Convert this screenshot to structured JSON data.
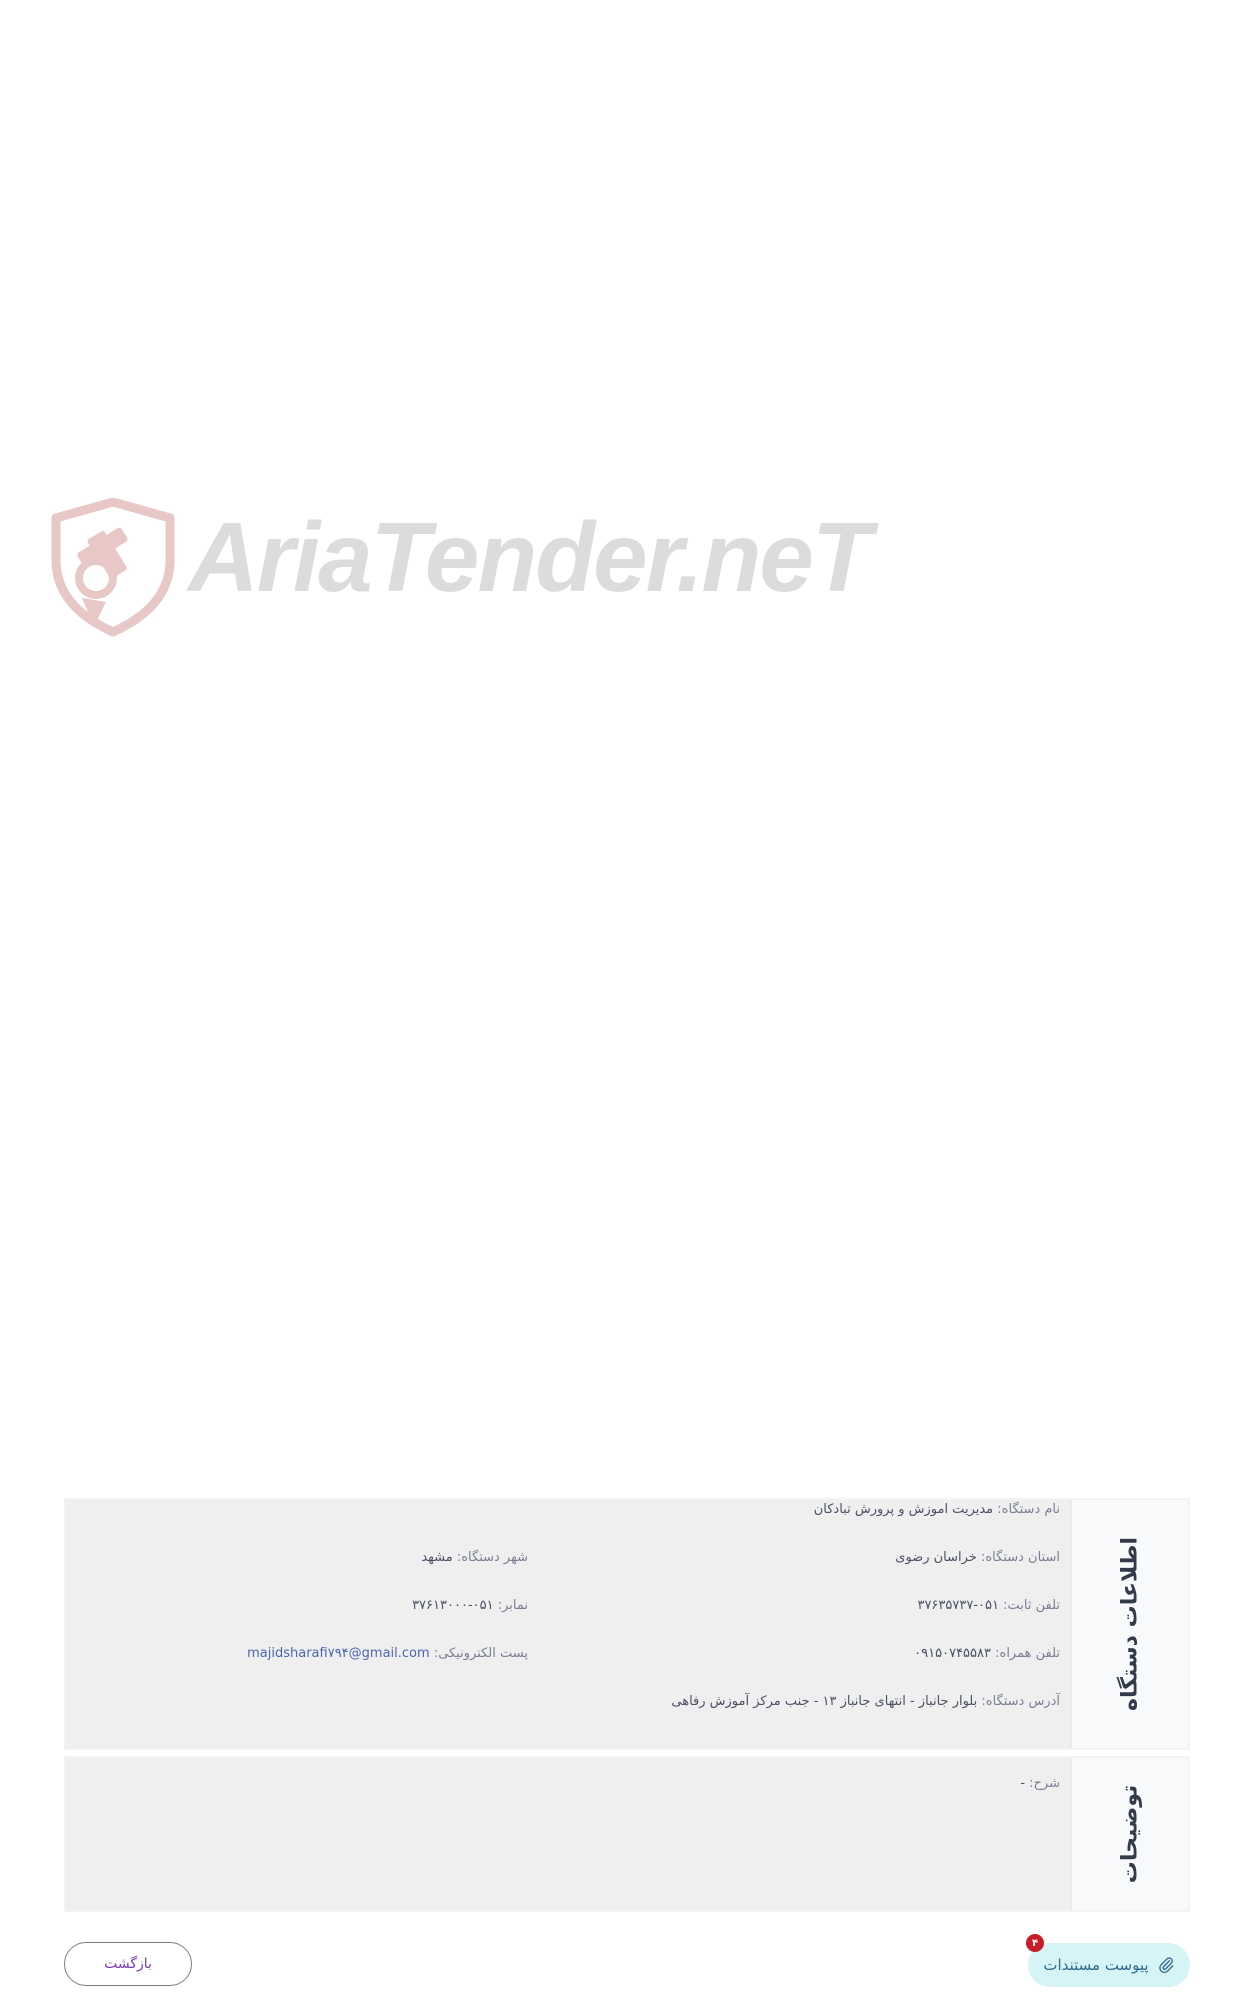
{
  "watermark": {
    "brand_text": "AriaTender.neT",
    "logo_color": "#e8c7c7",
    "text_color": "#dcdcdc"
  },
  "device_info": {
    "title": "اطلاعات دستگاه",
    "fields": {
      "name": {
        "label": "نام دستگاه:",
        "value": "مدیریت اموزش و پرورش تبادکان"
      },
      "province": {
        "label": "استان دستگاه:",
        "value": "خراسان رضوی"
      },
      "city": {
        "label": "شهر دستگاه:",
        "value": "مشهد"
      },
      "phone": {
        "label": "تلفن ثابت:",
        "value": "۰۵۱-۳۷۶۳۵۷۳۷"
      },
      "fax": {
        "label": "نمابر:",
        "value": "۰۵۱-۳۷۶۱۳۰۰۰"
      },
      "mobile": {
        "label": "تلفن همراه:",
        "value": "۰۹۱۵۰۷۴۵۵۸۳"
      },
      "email": {
        "label": "پست الکترونیکی:",
        "value": "majidsharafi۷۹۴@gmail.com"
      },
      "address": {
        "label": "آدرس دستگاه:",
        "value": "بلوار جانباز - انتهای جانباز ۱۳ - جنب مرکز آموزش رفاهی"
      }
    }
  },
  "description": {
    "title": "توضیحات",
    "label": "شرح:",
    "value": "-"
  },
  "actions": {
    "attachments_label": "پیوست مستندات",
    "attachments_count": "۴",
    "back_label": "بازگشت"
  },
  "colors": {
    "panel_bg": "#efefef",
    "attach_bg": "#d6f3f6",
    "badge_bg": "#c81e2a",
    "back_text": "#7a3fb0"
  }
}
